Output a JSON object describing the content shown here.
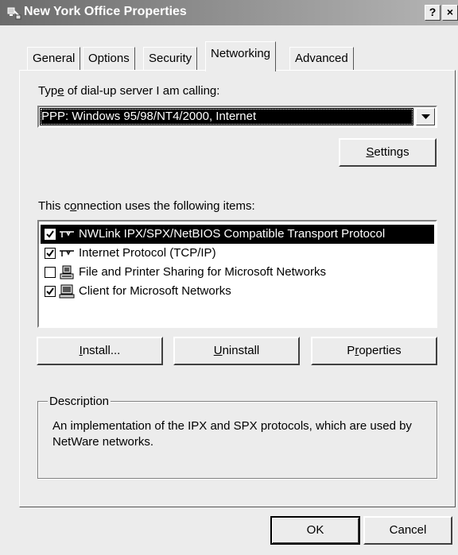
{
  "window": {
    "title": "New York Office Properties",
    "help_label": "?",
    "close_label": "×"
  },
  "tabs": [
    {
      "label": "General"
    },
    {
      "label": "Options"
    },
    {
      "label": "Security"
    },
    {
      "label": "Networking",
      "active": true
    },
    {
      "label": "Advanced"
    }
  ],
  "server_type": {
    "label_pre": "Typ",
    "label_ul": "e",
    "label_post": " of dial-up server I am calling:",
    "selected": "PPP: Windows 95/98/NT4/2000, Internet"
  },
  "settings_button": {
    "ul": "S",
    "rest": "ettings"
  },
  "items_section": {
    "label_pre": "This c",
    "label_ul": "o",
    "label_post": "nnection uses the following items:"
  },
  "items": [
    {
      "label": "NWLink IPX/SPX/NetBIOS Compatible Transport Protocol",
      "checked": true,
      "selected": true,
      "icon": "protocol-icon"
    },
    {
      "label": "Internet Protocol (TCP/IP)",
      "checked": true,
      "selected": false,
      "icon": "protocol-icon"
    },
    {
      "label": "File and Printer Sharing for Microsoft Networks",
      "checked": false,
      "selected": false,
      "icon": "service-computer-icon"
    },
    {
      "label": "Client for Microsoft Networks",
      "checked": true,
      "selected": false,
      "icon": "client-computer-icon"
    }
  ],
  "actions": {
    "install": {
      "ul": "I",
      "rest": "nstall..."
    },
    "uninstall": {
      "ul": "U",
      "rest": "ninstall"
    },
    "properties": {
      "pre": "P",
      "ul": "r",
      "rest": "operties"
    }
  },
  "description": {
    "legend": "Description",
    "text": "An implementation of the IPX and SPX protocols, which are used by NetWare networks."
  },
  "footer": {
    "ok": "OK",
    "cancel": "Cancel"
  }
}
